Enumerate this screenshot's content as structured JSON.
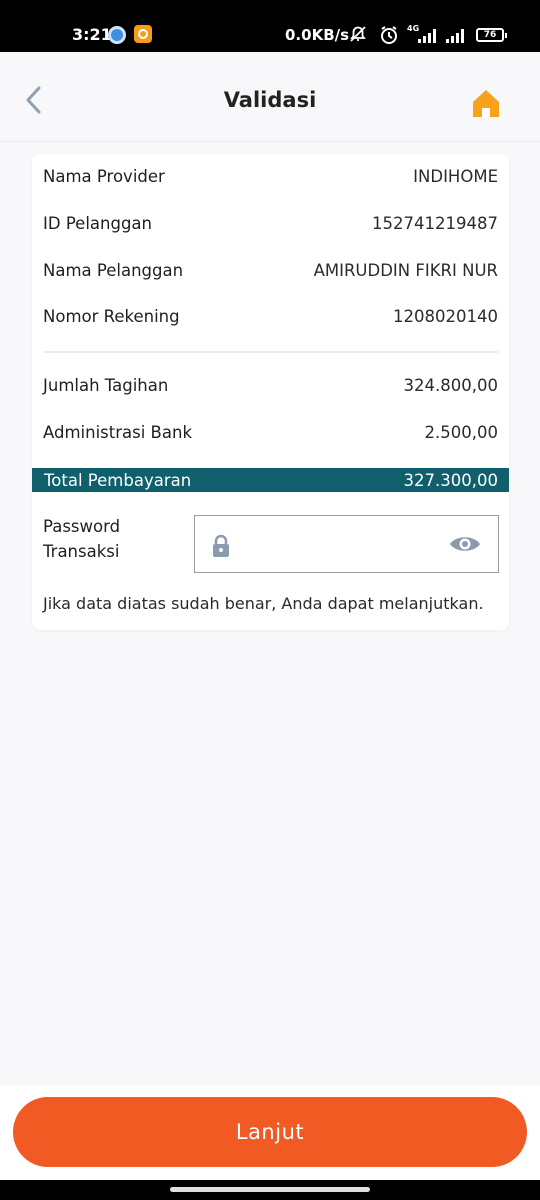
{
  "status_bar": {
    "time": "3:21",
    "net_speed": "0.0KB/s",
    "network_type": "4G",
    "battery": "76"
  },
  "header": {
    "title": "Validasi",
    "back_icon": "chevron-left-icon",
    "home_icon": "home-icon",
    "accent_color": "#f7a21b"
  },
  "details": [
    {
      "label": "Nama Provider",
      "value": "INDIHOME"
    },
    {
      "label": "ID Pelanggan",
      "value": "152741219487"
    },
    {
      "label": "Nama Pelanggan",
      "value": "AMIRUDDIN FIKRI NUR"
    },
    {
      "label": "Nomor Rekening",
      "value": "1208020140"
    }
  ],
  "charges": [
    {
      "label": "Jumlah Tagihan",
      "value": "324.800,00"
    },
    {
      "label": "Administrasi Bank",
      "value": "2.500,00"
    }
  ],
  "total": {
    "label": "Total Pembayaran",
    "value": "327.300,00",
    "color": "#0f5f6c"
  },
  "password": {
    "label": "Password Transaksi",
    "value": "",
    "lock_icon": "lock-icon",
    "eye_icon": "eye-icon"
  },
  "note": "Jika data diatas sudah benar, Anda dapat melanjutkan.",
  "cta": {
    "label": "Lanjut",
    "color": "#f15a22"
  }
}
